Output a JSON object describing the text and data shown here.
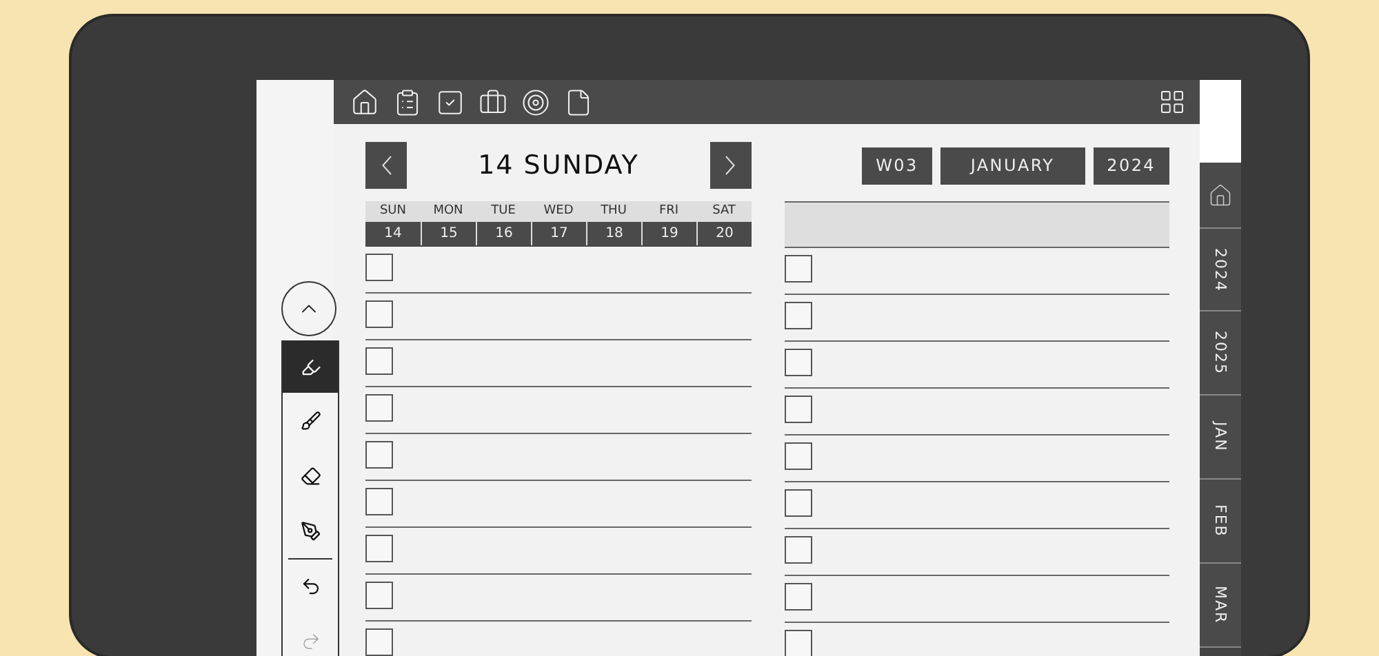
{
  "day_header": {
    "title": "14 SUNDAY"
  },
  "week": [
    {
      "day": "SUN",
      "date": "14"
    },
    {
      "day": "MON",
      "date": "15"
    },
    {
      "day": "TUE",
      "date": "16"
    },
    {
      "day": "WED",
      "date": "17"
    },
    {
      "day": "THU",
      "date": "18"
    },
    {
      "day": "FRI",
      "date": "19"
    },
    {
      "day": "SAT",
      "date": "20"
    }
  ],
  "chips": [
    "W03",
    "JANUARY",
    "2024"
  ],
  "left_tasks": [
    {
      "checked": false
    },
    {
      "checked": false
    },
    {
      "checked": false
    },
    {
      "checked": false
    },
    {
      "checked": false
    },
    {
      "checked": false
    },
    {
      "checked": false
    },
    {
      "checked": false
    },
    {
      "checked": false
    }
  ],
  "right_tasks": [
    {
      "checked": false
    },
    {
      "checked": false
    },
    {
      "checked": false
    },
    {
      "checked": false
    },
    {
      "checked": false
    },
    {
      "checked": false
    },
    {
      "checked": false
    },
    {
      "checked": false
    },
    {
      "checked": false
    }
  ],
  "tools": [
    {
      "kind": "highlighter",
      "selected": true
    },
    {
      "kind": "marker",
      "selected": false
    },
    {
      "kind": "eraser",
      "selected": false
    },
    {
      "kind": "pen",
      "selected": false
    },
    {
      "kind": "undo",
      "selected": false
    },
    {
      "kind": "redo",
      "selected": false
    }
  ],
  "side_tabs": [
    {
      "kind": "home"
    },
    {
      "kind": "text",
      "label": "2024"
    },
    {
      "kind": "text",
      "label": "2025"
    },
    {
      "kind": "text",
      "label": "JAN"
    },
    {
      "kind": "text",
      "label": "FEB"
    },
    {
      "kind": "text",
      "label": "MAR"
    }
  ]
}
